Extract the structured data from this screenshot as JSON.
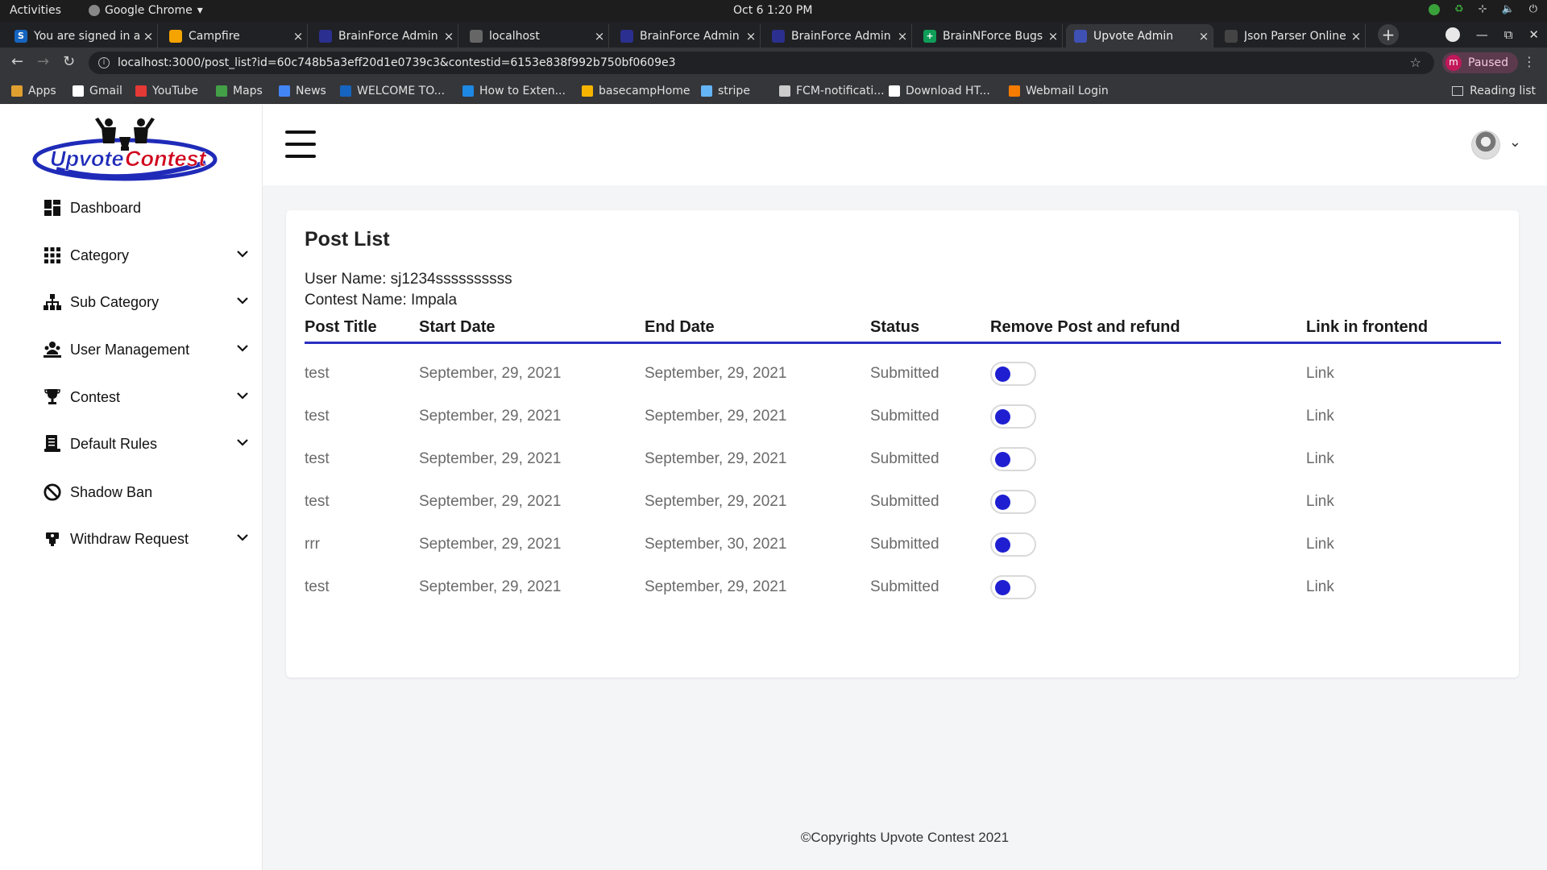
{
  "os": {
    "activities": "Activities",
    "app_name": "Google Chrome",
    "clock": "Oct 6   1:20 PM"
  },
  "browser": {
    "tabs": [
      {
        "label": "You are signed in a",
        "color": "#1565c0",
        "glyph": "S"
      },
      {
        "label": "Campfire",
        "color": "#f4a300",
        "glyph": ""
      },
      {
        "label": "BrainForce Admin",
        "color": "#2b2f8f",
        "glyph": ""
      },
      {
        "label": "localhost",
        "color": "#666666",
        "glyph": ""
      },
      {
        "label": "BrainForce Admin",
        "color": "#2b2f8f",
        "glyph": ""
      },
      {
        "label": "BrainForce Admin",
        "color": "#2b2f8f",
        "glyph": ""
      },
      {
        "label": "BrainNForce Bugs",
        "color": "#0f9d58",
        "glyph": "+"
      },
      {
        "label": "Upvote Admin",
        "color": "#3f51b5",
        "glyph": ""
      },
      {
        "label": "Json Parser Online",
        "color": "#444444",
        "glyph": ""
      }
    ],
    "active_tab": 7,
    "url": "localhost:3000/post_list?id=60c748b5a3eff20d1e0739c3&contestid=6153e838f992b750bf0609e3",
    "profile_initial": "m",
    "profile_status": "Paused",
    "bookmarks": [
      {
        "label": "Apps",
        "color": "#e0a030"
      },
      {
        "label": "Gmail",
        "color": "#ffffff"
      },
      {
        "label": "YouTube",
        "color": "#e53935"
      },
      {
        "label": "Maps",
        "color": "#43a047"
      },
      {
        "label": "News",
        "color": "#4285f4"
      },
      {
        "label": "WELCOME TO...",
        "color": "#1565c0"
      },
      {
        "label": "How to Exten...",
        "color": "#1e88e5"
      },
      {
        "label": "basecampHome",
        "color": "#f4b400"
      },
      {
        "label": "stripe",
        "color": "#64b5f6"
      },
      {
        "label": "FCM-notificati...",
        "color": "#cccccc"
      },
      {
        "label": "Download HT...",
        "color": "#ffffff"
      },
      {
        "label": "Webmail Login",
        "color": "#f57c00"
      }
    ],
    "reading_list": "Reading list"
  },
  "app": {
    "logo_text": "UpvoteContest",
    "sidebar": [
      {
        "label": "Dashboard",
        "icon": "dashboard-icon",
        "expandable": false
      },
      {
        "label": "Category",
        "icon": "grid-icon",
        "expandable": true
      },
      {
        "label": "Sub Category",
        "icon": "sitemap-icon",
        "expandable": true
      },
      {
        "label": "User Management",
        "icon": "users-icon",
        "expandable": true
      },
      {
        "label": "Contest",
        "icon": "trophy-icon",
        "expandable": true
      },
      {
        "label": "Default Rules",
        "icon": "rules-icon",
        "expandable": true
      },
      {
        "label": "Shadow Ban",
        "icon": "ban-icon",
        "expandable": false
      },
      {
        "label": "Withdraw Request",
        "icon": "withdraw-icon",
        "expandable": true
      }
    ],
    "page_title": "Post List",
    "user_name_line": "User Name: sj1234ssssssssss",
    "contest_name_line": "Contest Name: Impala",
    "columns": [
      "Post Title",
      "Start Date",
      "End Date",
      "Status",
      "Remove Post and refund",
      "Link in frontend"
    ],
    "rows": [
      {
        "title": "test",
        "start": "September, 29, 2021",
        "end": "September, 29, 2021",
        "status": "Submitted",
        "link": "Link"
      },
      {
        "title": "test",
        "start": "September, 29, 2021",
        "end": "September, 29, 2021",
        "status": "Submitted",
        "link": "Link"
      },
      {
        "title": "test",
        "start": "September, 29, 2021",
        "end": "September, 29, 2021",
        "status": "Submitted",
        "link": "Link"
      },
      {
        "title": "test",
        "start": "September, 29, 2021",
        "end": "September, 29, 2021",
        "status": "Submitted",
        "link": "Link"
      },
      {
        "title": "rrr",
        "start": "September, 29, 2021",
        "end": "September, 30, 2021",
        "status": "Submitted",
        "link": "Link"
      },
      {
        "title": "test",
        "start": "September, 29, 2021",
        "end": "September, 29, 2021",
        "status": "Submitted",
        "link": "Link"
      }
    ],
    "footer": "©Copyrights Upvote Contest 2021",
    "colors": {
      "accent": "#2a2fc0",
      "toggle_knob": "#1f1fd1",
      "logo_red": "#d0021b",
      "logo_blue": "#1f2bb8"
    }
  }
}
